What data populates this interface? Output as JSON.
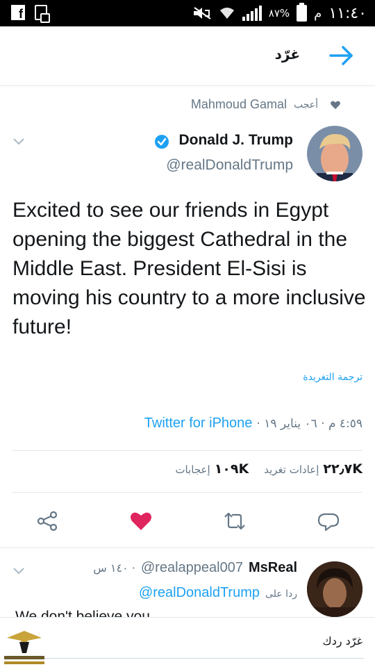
{
  "status_bar": {
    "time": "١١:٤٠",
    "ampm": "م",
    "battery_percent": "٨٧%"
  },
  "header": {
    "title": "غرّد"
  },
  "liked_by": {
    "label": "أعجب",
    "name": "Mahmoud Gamal"
  },
  "tweet": {
    "author_name": "Donald J. Trump",
    "author_handle": "@realDonaldTrump",
    "text": "Excited to see our friends in Egypt opening the biggest Cathedral in the Middle East. President El-Sisi is moving his country to a more inclusive future!",
    "translate_label": "ترجمة التغريدة",
    "timestamp": "٤:٥٩ م · ٠٦ يناير ١٩ ·",
    "source": "Twitter for iPhone",
    "retweets_count": "٢٢٫٧K",
    "retweets_label": "إعادات تغريد",
    "likes_count": "١٠٩K",
    "likes_label": "إعجابات"
  },
  "reply": {
    "name": "MsReal",
    "handle": "@realappeal007",
    "time": "· ١٤٠ س",
    "replying_label": "ردا على",
    "replying_to": "@realDonaldTrump",
    "text": "We don't believe you"
  },
  "compose": {
    "placeholder": "غرّد ردك"
  },
  "colors": {
    "accent": "#1da1f2",
    "like_red": "#e0245e",
    "muted": "#657786"
  }
}
